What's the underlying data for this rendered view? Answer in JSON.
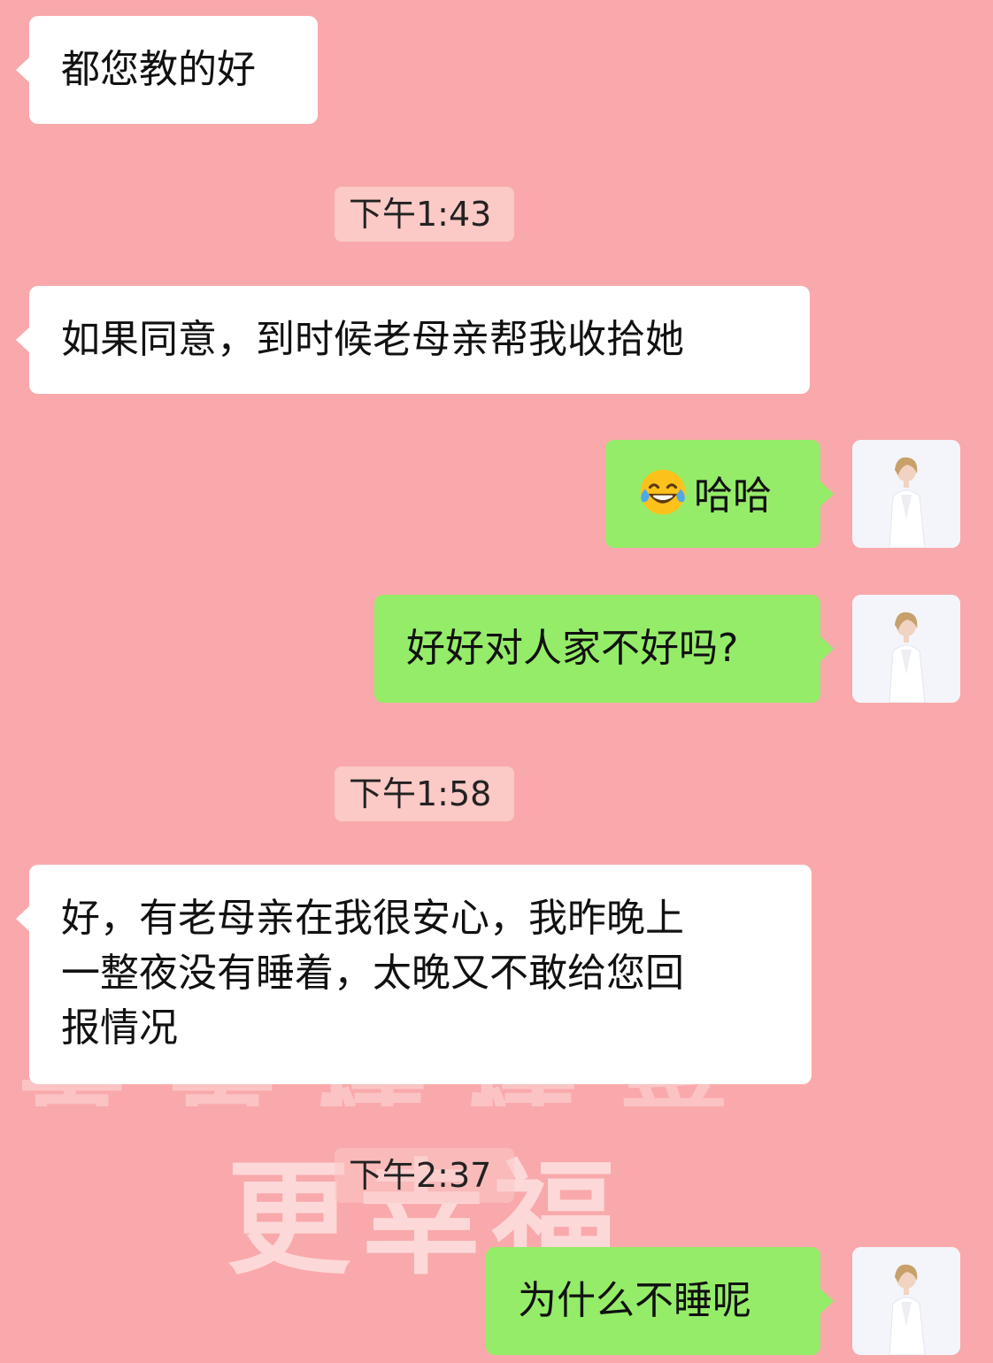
{
  "watermark": {
    "upper_text": "真真情情爱",
    "lower_text": "更幸福"
  },
  "messages": [
    {
      "kind": "in",
      "text": "都您教的好"
    },
    {
      "kind": "time",
      "text": "下午1:43"
    },
    {
      "kind": "in",
      "text": "如果同意，到时候老母亲帮我收拾她"
    },
    {
      "kind": "out",
      "emoji": "tears-of-joy-emoji",
      "text": "哈哈"
    },
    {
      "kind": "out",
      "text": "好好对人家不好吗?"
    },
    {
      "kind": "time",
      "text": "下午1:58"
    },
    {
      "kind": "in",
      "text": "好，有老母亲在我很安心，我昨晚上\n一整夜没有睡着，太晚又不敢给您回\n报情况"
    },
    {
      "kind": "time",
      "text": "下午2:37"
    },
    {
      "kind": "out",
      "text": "为什么不睡呢"
    }
  ],
  "colors": {
    "background": "#f9a9ab",
    "incoming_bubble": "#ffffff",
    "outgoing_bubble": "#95ec69",
    "timestamp_chip": "#fbc9c6"
  }
}
